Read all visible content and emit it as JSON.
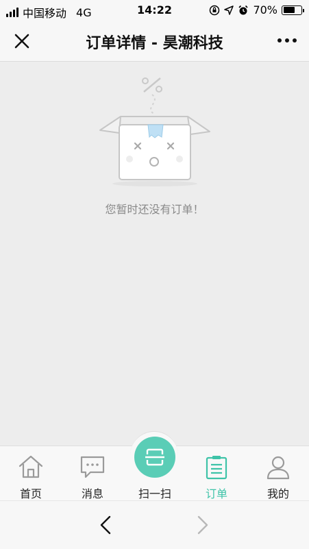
{
  "status_bar": {
    "carrier": "中国移动",
    "network": "4G",
    "time": "14:22",
    "battery_percent": "70%",
    "battery_level": 0.7
  },
  "nav": {
    "title": "订单详情 - 昊潮科技",
    "icons": {
      "left": "close-icon",
      "right": "more-icon"
    }
  },
  "empty_state": {
    "message": "您暂时还没有订单！",
    "icon": "empty-box-illustration"
  },
  "tab_bar": {
    "active_color": "#3ec3a8",
    "items": [
      {
        "label": "首页",
        "icon": "home-icon",
        "active": false
      },
      {
        "label": "消息",
        "icon": "message-icon",
        "active": false
      },
      {
        "label": "扫一扫",
        "icon": "scan-icon",
        "active": false
      },
      {
        "label": "订单",
        "icon": "order-icon",
        "active": true
      },
      {
        "label": "我的",
        "icon": "user-icon",
        "active": false
      }
    ]
  },
  "browser_bar": {
    "icons": {
      "back": "chevron-left-icon",
      "forward": "chevron-right-icon"
    }
  }
}
